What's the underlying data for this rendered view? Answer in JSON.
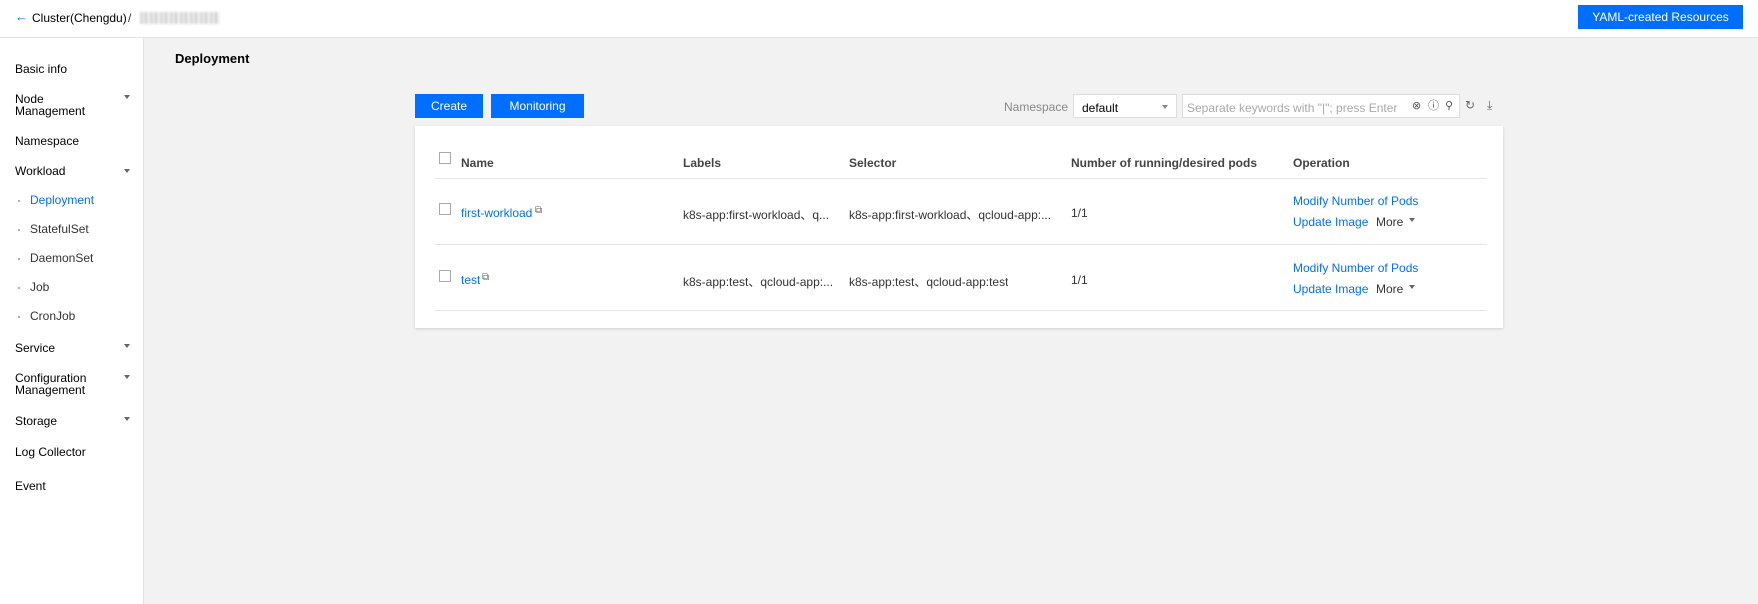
{
  "header": {
    "back_icon": "←",
    "cluster": "Cluster(Chengdu)",
    "separator": "/",
    "yaml_button": "YAML-created Resources"
  },
  "sidebar": {
    "basic_info": "Basic info",
    "node_management_1": "Node",
    "node_management_2": "Management",
    "namespace": "Namespace",
    "workload": "Workload",
    "deployment": "Deployment",
    "statefulset": "StatefulSet",
    "daemonset": "DaemonSet",
    "job": "Job",
    "cronjob": "CronJob",
    "service": "Service",
    "config_1": "Configuration",
    "config_2": "Management",
    "storage": "Storage",
    "log_collector": "Log Collector",
    "event": "Event"
  },
  "main": {
    "title": "Deployment",
    "create_button": "Create",
    "monitoring_button": "Monitoring",
    "namespace_label": "Namespace",
    "namespace_value": "default",
    "search_placeholder": "Separate keywords with \"|\"; press Enter"
  },
  "table": {
    "headers": {
      "name": "Name",
      "labels": "Labels",
      "selector": "Selector",
      "pods": "Number of running/desired pods",
      "operation": "Operation"
    },
    "rows": [
      {
        "name": "first-workload",
        "labels": "k8s-app:first-workload、q...",
        "selector": "k8s-app:first-workload、qcloud-app:...",
        "pods": "1/1",
        "op1": "Modify Number of Pods",
        "op2": "Update Image",
        "more": "More"
      },
      {
        "name": "test",
        "labels": "k8s-app:test、qcloud-app:...",
        "selector": "k8s-app:test、qcloud-app:test",
        "pods": "1/1",
        "op1": "Modify Number of Pods",
        "op2": "Update Image",
        "more": "More"
      }
    ]
  },
  "colors": {
    "accent": "#006eff",
    "page_bg": "#f2f2f2"
  }
}
